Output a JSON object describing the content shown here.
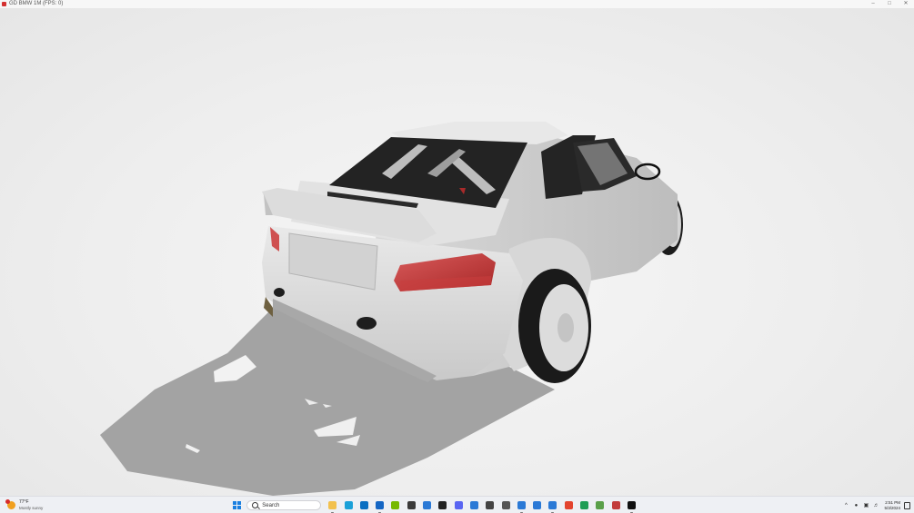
{
  "window": {
    "title": "GD BMW 1M (FPS: 0)",
    "controls": {
      "minimize": "–",
      "maximize": "□",
      "close": "✕"
    }
  },
  "scene": {
    "subject": "white-bmw-1m-widebody",
    "icons": {
      "car": "car-model",
      "shadow": "car-shadow"
    }
  },
  "taskbar": {
    "weather": {
      "temp": "77°F",
      "desc": "Mostly sunny",
      "icon": "sun-icon"
    },
    "search": {
      "placeholder": "Search"
    },
    "apps": [
      {
        "name": "file-explorer",
        "color": "#f2c14e",
        "running": true
      },
      {
        "name": "edge",
        "color": "#1aa0d8",
        "running": false
      },
      {
        "name": "store",
        "color": "#0a6fc2",
        "running": false
      },
      {
        "name": "outlook",
        "color": "#1466c4",
        "running": true
      },
      {
        "name": "nvidia",
        "color": "#76b900",
        "running": false
      },
      {
        "name": "game-tool",
        "color": "#3a3a3a",
        "running": false
      },
      {
        "name": "app-window",
        "color": "#2a79d6",
        "running": false
      },
      {
        "name": "github",
        "color": "#222222",
        "running": false
      },
      {
        "name": "discord",
        "color": "#5865f2",
        "running": false
      },
      {
        "name": "app-window-2",
        "color": "#2a79d6",
        "running": false
      },
      {
        "name": "text-tool",
        "color": "#444444",
        "running": false
      },
      {
        "name": "capture",
        "color": "#555555",
        "running": false
      },
      {
        "name": "app-window-3",
        "color": "#2a79d6",
        "running": true
      },
      {
        "name": "app-window-4",
        "color": "#2a79d6",
        "running": false
      },
      {
        "name": "app-window-5",
        "color": "#2a79d6",
        "running": true
      },
      {
        "name": "chrome",
        "color": "#e3442f",
        "running": false
      },
      {
        "name": "sheets",
        "color": "#1f9d55",
        "running": false
      },
      {
        "name": "notepad",
        "color": "#5aa04a",
        "running": false
      },
      {
        "name": "ftp-tool",
        "color": "#c23b3b",
        "running": false
      },
      {
        "name": "terminal",
        "color": "#101010",
        "running": true
      }
    ],
    "tray": {
      "chevron": "^",
      "clock_time": "2:51 PM",
      "clock_date": "5/3/2024"
    }
  }
}
